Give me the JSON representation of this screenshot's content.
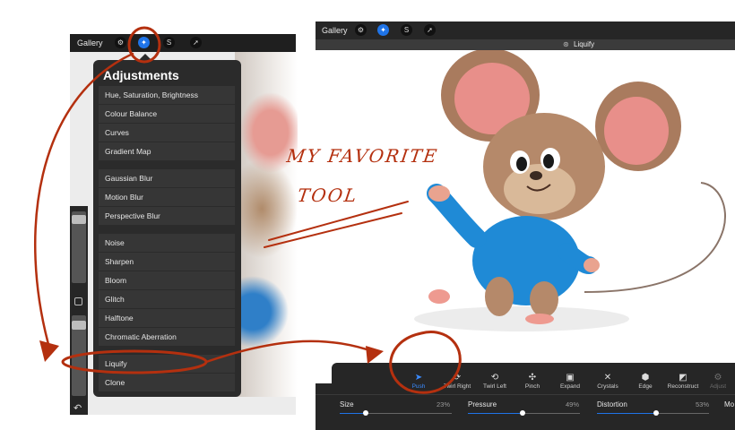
{
  "left_app": {
    "gallery_label": "Gallery",
    "toolbar_icons": [
      "wrench-icon",
      "magic-wand-icon",
      "selection-icon",
      "transform-arrow-icon"
    ],
    "active_icon": "magic-wand-icon"
  },
  "adjustments": {
    "title": "Adjustments",
    "items": [
      "Hue, Saturation, Brightness",
      "Colour Balance",
      "Curves",
      "Gradient Map",
      "Gaussian Blur",
      "Motion Blur",
      "Perspective Blur",
      "Noise",
      "Sharpen",
      "Bloom",
      "Glitch",
      "Halftone",
      "Chromatic Aberration",
      "Liquify",
      "Clone"
    ]
  },
  "right_app": {
    "gallery_label": "Gallery",
    "mode_title": "Liquify",
    "tools": [
      {
        "label": "Push",
        "icon": "push-icon"
      },
      {
        "label": "Twirl Right",
        "icon": "twirl-right-icon"
      },
      {
        "label": "Twirl Left",
        "icon": "twirl-left-icon"
      },
      {
        "label": "Pinch",
        "icon": "pinch-icon"
      },
      {
        "label": "Expand",
        "icon": "expand-icon"
      },
      {
        "label": "Crystals",
        "icon": "crystals-icon"
      },
      {
        "label": "Edge",
        "icon": "edge-icon"
      },
      {
        "label": "Reconstruct",
        "icon": "reconstruct-icon"
      },
      {
        "label": "Adjust",
        "icon": "adjust-icon"
      }
    ],
    "selected_tool": "Push",
    "sliders": [
      {
        "label": "Size",
        "value": "23%",
        "level": 0.23
      },
      {
        "label": "Pressure",
        "value": "49%",
        "level": 0.49
      },
      {
        "label": "Distortion",
        "value": "53%",
        "level": 0.53
      },
      {
        "label": "Mo",
        "value": "",
        "level": 0
      }
    ]
  },
  "annotation": {
    "line1": "MY FAVORITE",
    "line2": "TOOL"
  },
  "colors": {
    "accent_blue": "#1f74e8",
    "annotation_red": "#b4300f",
    "panel_dark": "#2b2b2b"
  }
}
